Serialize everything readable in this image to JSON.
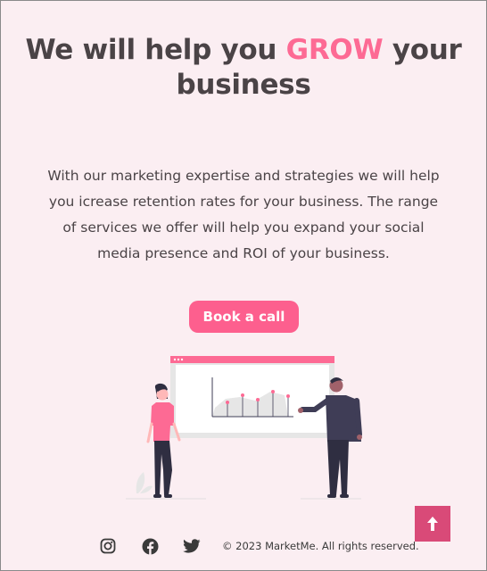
{
  "hero": {
    "title_before": "We will help you ",
    "title_accent": "GROW",
    "title_after": " your business",
    "description": "With our marketing expertise and strategies we will help you icrease retention rates for your business. The range of services we offer will help you expand your social media presence and ROI of your business."
  },
  "cta": {
    "label": "Book a call"
  },
  "back_to_top": {
    "icon": "arrow-up-icon"
  },
  "footer": {
    "social": [
      {
        "name": "instagram-icon"
      },
      {
        "name": "facebook-icon"
      },
      {
        "name": "twitter-icon"
      }
    ],
    "copyright": "© 2023 MarketMe. All rights reserved."
  },
  "colors": {
    "background": "#fbeef2",
    "accent": "#fd6a94",
    "button": "#fd5f8e",
    "back_to_top": "#d94a78",
    "text": "#4a4346"
  }
}
